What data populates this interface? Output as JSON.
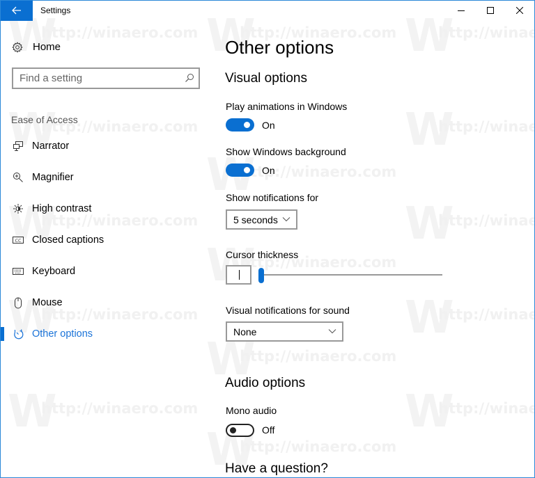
{
  "window": {
    "title": "Settings",
    "accent_color": "#0a6fd1",
    "controls": {
      "minimize": "minimize-icon",
      "maximize": "maximize-icon",
      "close": "close-icon"
    }
  },
  "watermark": {
    "text": "http://winaero.com",
    "letter": "W"
  },
  "sidebar": {
    "home_label": "Home",
    "search_placeholder": "Find a setting",
    "section_label": "Ease of Access",
    "items": [
      {
        "label": "Narrator",
        "icon": "narrator-icon"
      },
      {
        "label": "Magnifier",
        "icon": "magnifier-icon"
      },
      {
        "label": "High contrast",
        "icon": "high-contrast-icon"
      },
      {
        "label": "Closed captions",
        "icon": "closed-captions-icon"
      },
      {
        "label": "Keyboard",
        "icon": "keyboard-icon"
      },
      {
        "label": "Mouse",
        "icon": "mouse-icon"
      },
      {
        "label": "Other options",
        "icon": "other-options-icon",
        "active": true
      }
    ]
  },
  "main": {
    "title": "Other options",
    "visual_heading": "Visual options",
    "play_animations": {
      "label": "Play animations in Windows",
      "state": "On",
      "on": true
    },
    "show_background": {
      "label": "Show Windows background",
      "state": "On",
      "on": true
    },
    "notifications": {
      "label": "Show notifications for",
      "value": "5 seconds"
    },
    "cursor": {
      "label": "Cursor thickness",
      "value": 1,
      "min": 1,
      "max": 20
    },
    "visual_sound": {
      "label": "Visual notifications for sound",
      "value": "None"
    },
    "audio_heading": "Audio options",
    "mono_audio": {
      "label": "Mono audio",
      "state": "Off",
      "on": false
    },
    "question_heading": "Have a question?"
  }
}
